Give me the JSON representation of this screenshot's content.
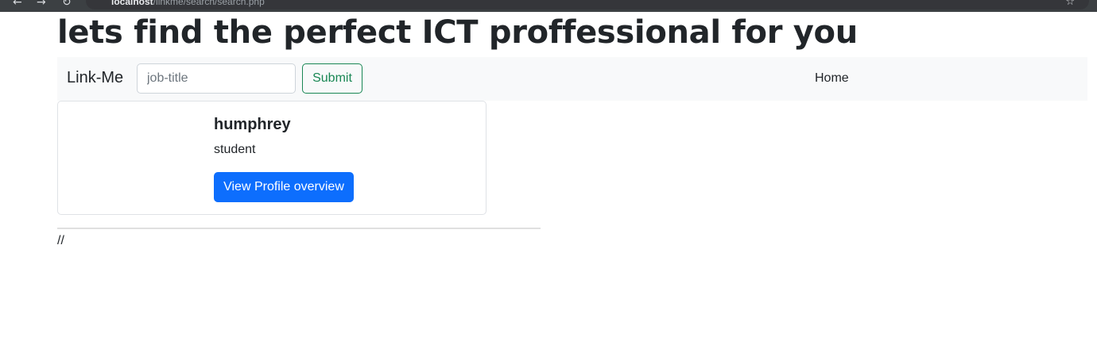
{
  "browser": {
    "back_icon": "arrow-left-icon",
    "forward_icon": "arrow-right-icon",
    "reload_icon": "reload-icon",
    "url_host": "localhost",
    "url_path": "/linkme/search/search.php",
    "bookmark_icon": "star-icon"
  },
  "page": {
    "heading": "lets find the perfect ICT proffessional for you"
  },
  "navbar": {
    "brand": "Link-Me",
    "search_placeholder": "job-title",
    "search_value": "",
    "submit_label": "Submit",
    "home_label": "Home"
  },
  "results": [
    {
      "name": "humphrey",
      "role": "student",
      "button_label": "View Profile overview"
    }
  ],
  "footer": {
    "text": "//"
  },
  "colors": {
    "navbar_bg": "#f8f9fa",
    "submit_outline": "#198754",
    "primary_button": "#0d6efd",
    "browser_chrome": "#3c4043"
  }
}
